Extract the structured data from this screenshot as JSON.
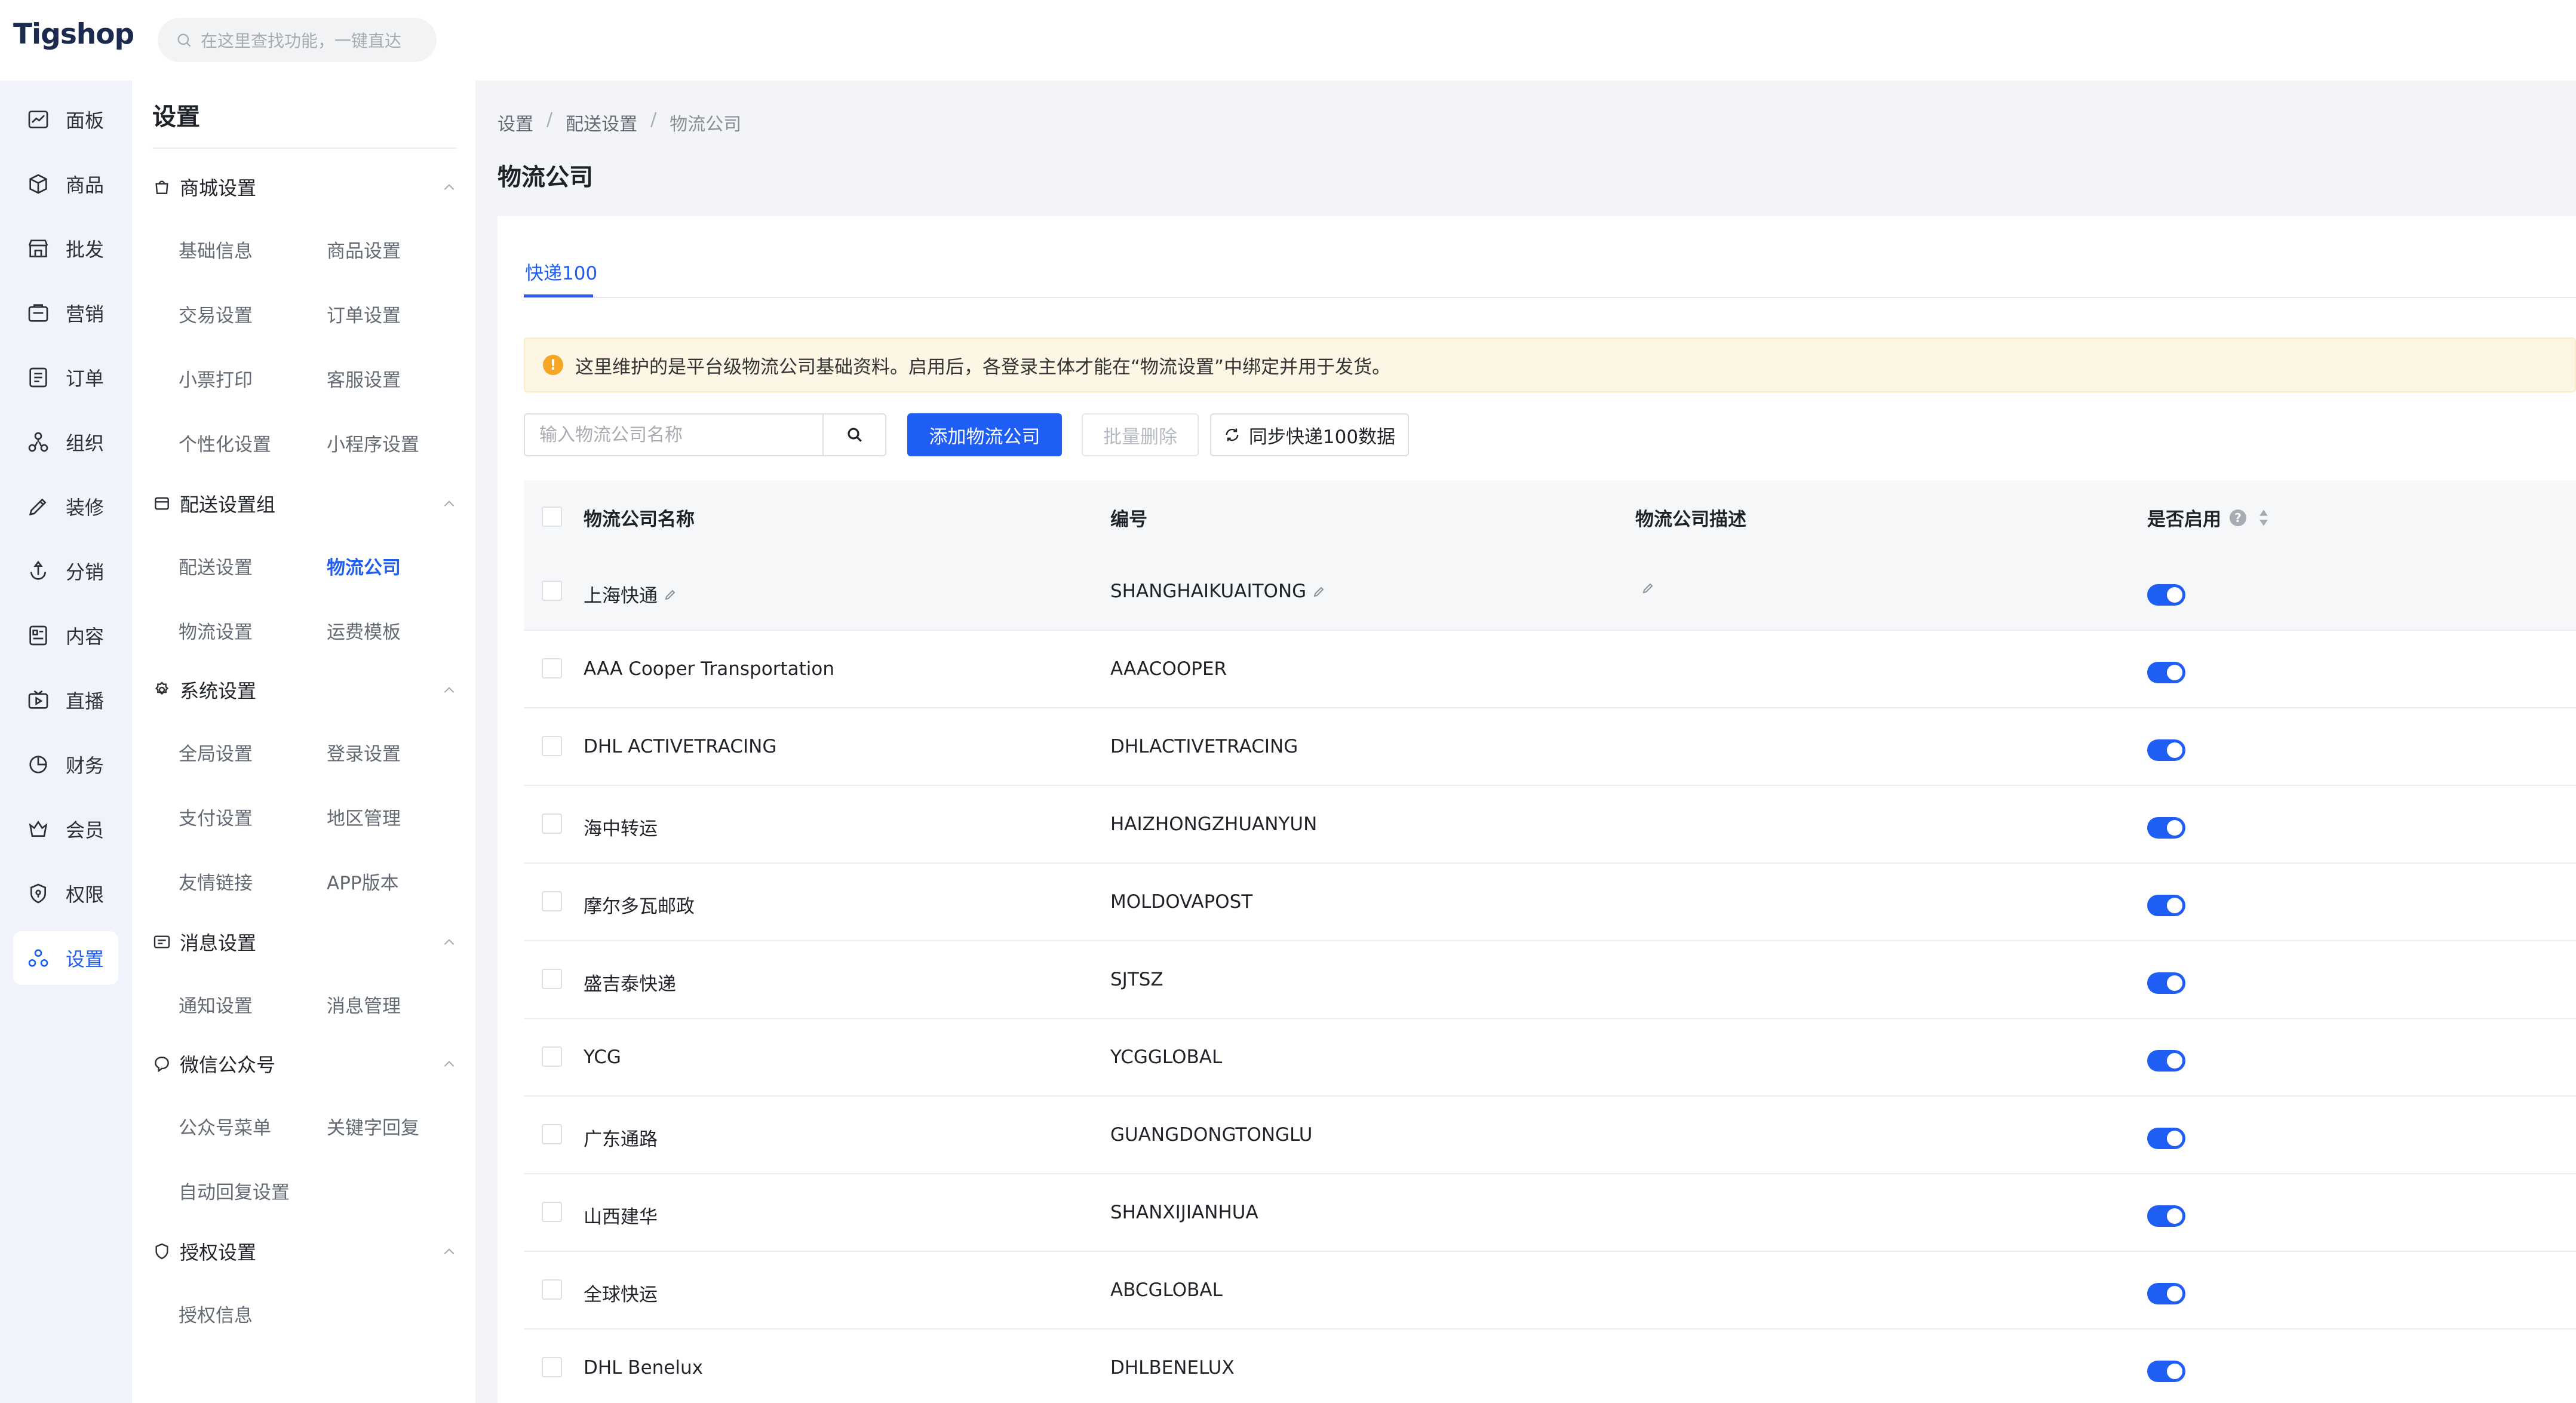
{
  "brand": "Tigshop",
  "search": {
    "placeholder": "在这里查找功能，一键直达"
  },
  "nav": [
    {
      "label": "面板",
      "icon": "dashboard-icon"
    },
    {
      "label": "商品",
      "icon": "product-icon"
    },
    {
      "label": "批发",
      "icon": "wholesale-icon"
    },
    {
      "label": "营销",
      "icon": "marketing-icon"
    },
    {
      "label": "订单",
      "icon": "order-icon"
    },
    {
      "label": "组织",
      "icon": "organization-icon"
    },
    {
      "label": "装修",
      "icon": "decoration-icon"
    },
    {
      "label": "分销",
      "icon": "distribution-icon"
    },
    {
      "label": "内容",
      "icon": "content-icon"
    },
    {
      "label": "直播",
      "icon": "live-icon"
    },
    {
      "label": "财务",
      "icon": "finance-icon"
    },
    {
      "label": "会员",
      "icon": "member-icon"
    },
    {
      "label": "权限",
      "icon": "permission-icon"
    },
    {
      "label": "设置",
      "icon": "settings-icon",
      "active": true
    }
  ],
  "submenu": {
    "title": "设置",
    "groups": [
      {
        "label": "商城设置",
        "links": [
          "基础信息",
          "商品设置",
          "交易设置",
          "订单设置",
          "小票打印",
          "客服设置",
          "个性化设置",
          "小程序设置"
        ]
      },
      {
        "label": "配送设置组",
        "links": [
          "配送设置",
          "物流公司",
          "物流设置",
          "运费模板"
        ]
      },
      {
        "label": "系统设置",
        "links": [
          "全局设置",
          "登录设置",
          "支付设置",
          "地区管理",
          "友情链接",
          "APP版本"
        ]
      },
      {
        "label": "消息设置",
        "links": [
          "通知设置",
          "消息管理"
        ]
      },
      {
        "label": "微信公众号",
        "links": [
          "公众号菜单",
          "关键字回复",
          "自动回复设置"
        ]
      },
      {
        "label": "授权设置",
        "links": [
          "授权信息"
        ]
      }
    ],
    "active_link": "物流公司"
  },
  "breadcrumb": [
    "设置",
    "配送设置",
    "物流公司"
  ],
  "breadcrumb_sep": "/",
  "page_title": "物流公司",
  "tabs": [
    "快递100"
  ],
  "notice": "这里维护的是平台级物流公司基础资料。启用后，各登录主体才能在“物流设置”中绑定并用于发货。",
  "toolbar": {
    "input_placeholder": "输入物流公司名称",
    "add_label": "添加物流公司",
    "batch_delete_label": "批量删除",
    "sync_label": "同步快递100数据"
  },
  "table": {
    "headers": [
      "物流公司名称",
      "编号",
      "物流公司描述",
      "是否启用"
    ],
    "rows": [
      {
        "name": "上海快通",
        "code": "SHANGHAIKUAITONG",
        "desc": "",
        "enabled": true
      },
      {
        "name": "AAA Cooper Transportation",
        "code": "AAACOOPER",
        "desc": "",
        "enabled": true
      },
      {
        "name": "DHL ACTIVETRACING",
        "code": "DHLACTIVETRACING",
        "desc": "",
        "enabled": true
      },
      {
        "name": "海中转运",
        "code": "HAIZHONGZHUANYUN",
        "desc": "",
        "enabled": true
      },
      {
        "name": "摩尔多瓦邮政",
        "code": "MOLDOVAPOST",
        "desc": "",
        "enabled": true
      },
      {
        "name": "盛吉泰快递",
        "code": "SJTSZ",
        "desc": "",
        "enabled": true
      },
      {
        "name": "YCG",
        "code": "YCGGLOBAL",
        "desc": "",
        "enabled": true
      },
      {
        "name": "广东通路",
        "code": "GUANGDONGTONGLU",
        "desc": "",
        "enabled": true
      },
      {
        "name": "山西建华",
        "code": "SHANXIJIANHUA",
        "desc": "",
        "enabled": true
      },
      {
        "name": "全球快运",
        "code": "ABCGLOBAL",
        "desc": "",
        "enabled": true
      },
      {
        "name": "DHL Benelux",
        "code": "DHLBENELUX",
        "desc": "",
        "enabled": true
      }
    ]
  },
  "colors": {
    "primary": "#1f5ef4",
    "notice_bg": "#fdf6e5",
    "warning": "#f5a623",
    "nav_bg": "#f0f3fb"
  }
}
